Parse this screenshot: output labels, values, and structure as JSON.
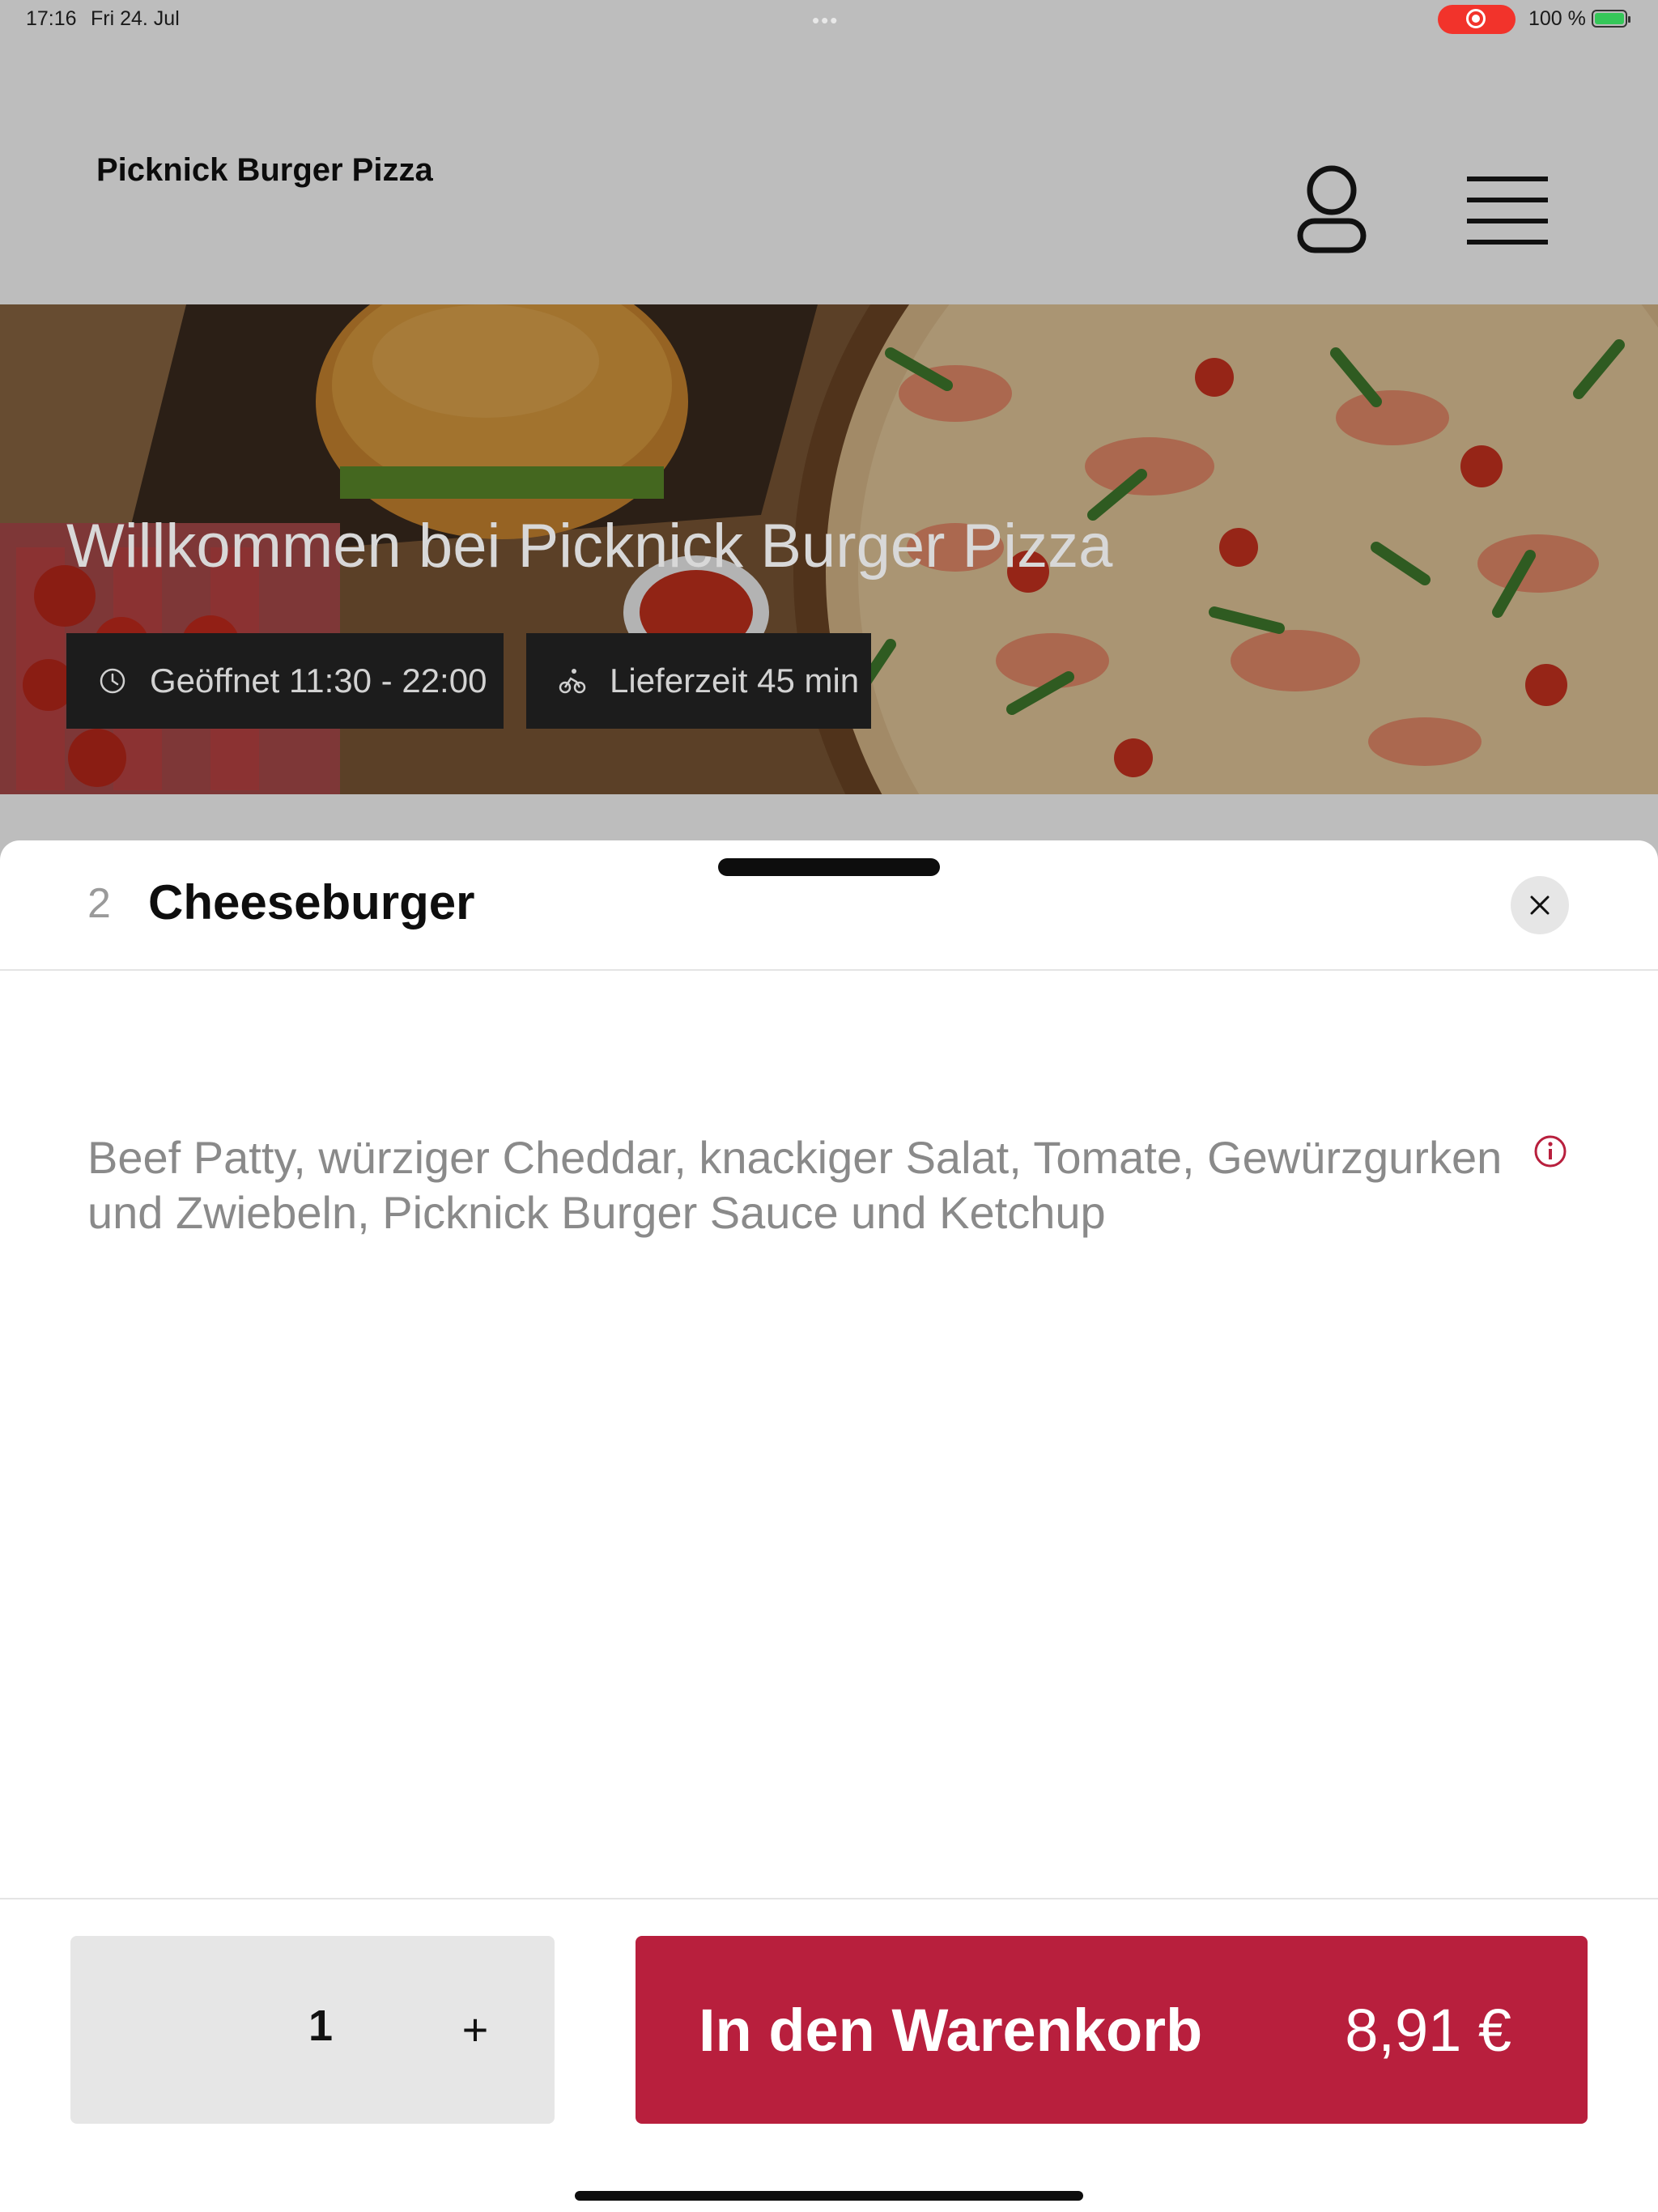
{
  "status_bar": {
    "time": "17:16",
    "date": "Fri 24. Jul",
    "battery": "100 %"
  },
  "header": {
    "brand": "Picknick Burger Pizza",
    "icons": [
      "user-icon",
      "menu-icon"
    ]
  },
  "hero": {
    "title": "Willkommen bei Picknick Burger Pizza",
    "opening_hours": "Geöffnet 11:30 - 22:00",
    "delivery_time": "Lieferzeit 45 min"
  },
  "product_sheet": {
    "item_number": "2",
    "item_name": "Cheeseburger",
    "description": "Beef Patty, würziger Cheddar, knackiger Salat, Tomate, Gewürzgurken und Zwiebeln, Picknick Burger Sauce und Ketchup",
    "quantity": "1",
    "plus_label": "+",
    "cart_label": "In den Warenkorb",
    "price": "8,91 €"
  },
  "colors": {
    "accent": "#b81f3d",
    "header_bg": "#bdbdbd",
    "chip_bg": "#1c1c1c",
    "record_indicator": "#f2332b",
    "battery_fill": "#35c759"
  }
}
